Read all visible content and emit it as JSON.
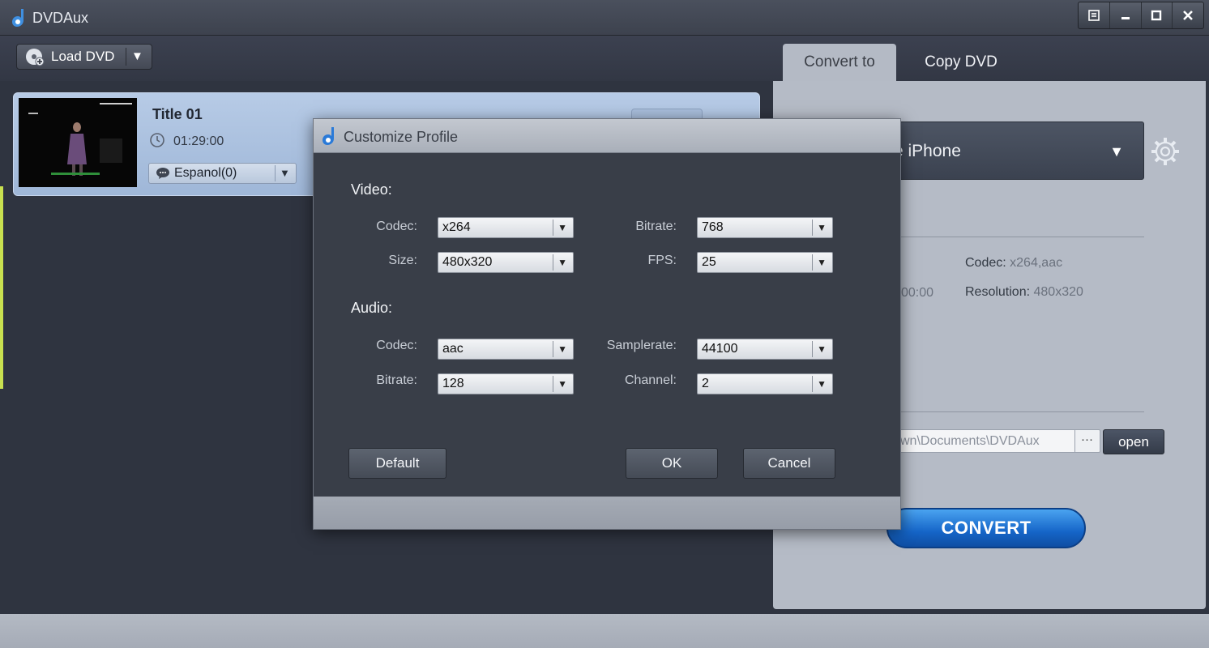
{
  "window": {
    "title": "DVDAux"
  },
  "toolbar": {
    "load_dvd_label": "Load DVD",
    "load_dvd_arrow": "▼"
  },
  "tabs": [
    {
      "label": "Convert to",
      "active": true
    },
    {
      "label": "Copy DVD",
      "active": false
    }
  ],
  "title_item": {
    "name": "Title 01",
    "duration": "01:29:00",
    "subtitle": "Espanol(0)"
  },
  "right_panel": {
    "profile_value": "e iPhone",
    "codec_label": "Codec:",
    "codec_value": "x264,aac",
    "resolution_label": "Resolution:",
    "resolution_value": "480x320",
    "duration_fragment": "00:00",
    "output_path": "wn\\Documents\\DVDAux",
    "browse_label": "···",
    "open_label": "open",
    "convert_label": "CONVERT"
  },
  "dialog": {
    "title": "Customize Profile",
    "video": {
      "section_label": "Video:",
      "codec_label": "Codec:",
      "codec_value": "x264",
      "bitrate_label": "Bitrate:",
      "bitrate_value": "768",
      "size_label": "Size:",
      "size_value": "480x320",
      "fps_label": "FPS:",
      "fps_value": "25"
    },
    "audio": {
      "section_label": "Audio:",
      "codec_label": "Codec:",
      "codec_value": "aac",
      "samplerate_label": "Samplerate:",
      "samplerate_value": "44100",
      "bitrate_label": "Bitrate:",
      "bitrate_value": "128",
      "channel_label": "Channel:",
      "channel_value": "2"
    },
    "buttons": {
      "default": "Default",
      "ok": "OK",
      "cancel": "Cancel"
    }
  },
  "icons": {
    "app_logo": "dvdaux-logo-icon",
    "menu": "menu-icon",
    "minimize": "minimize-icon",
    "maximize": "maximize-icon",
    "close": "close-icon",
    "load_dvd": "disc-add-icon",
    "clock": "clock-icon",
    "subtitle": "speech-bubble-icon",
    "settings": "gear-icon"
  },
  "colors": {
    "accent_blue": "#1565c8",
    "title_item_bg": "#b7cbe6",
    "dialog_bg": "#393e48"
  }
}
